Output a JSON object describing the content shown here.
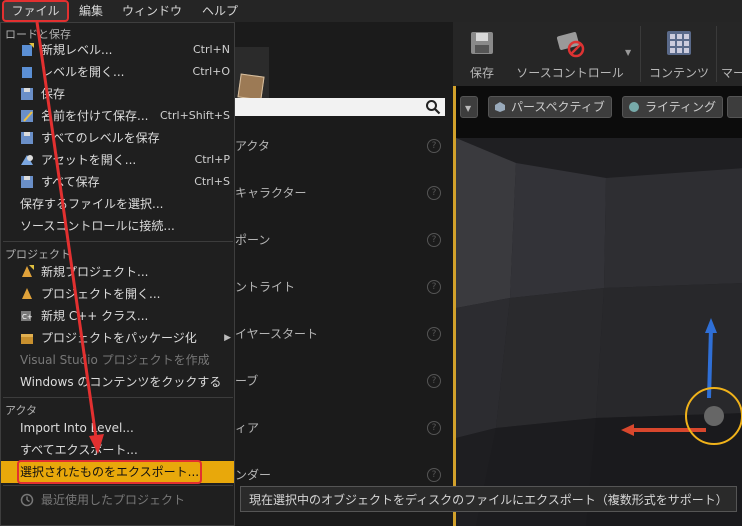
{
  "menubar": {
    "items": [
      "ファイル",
      "編集",
      "ウィンドウ",
      "ヘルプ"
    ]
  },
  "place_panel": {
    "search_placeholder": "",
    "items": [
      "アクタ",
      "キャラクター",
      "ポーン",
      "ントライト",
      "イヤースタート",
      "ーブ",
      "ィア",
      "ンダー"
    ]
  },
  "toolbar": {
    "save": "保存",
    "source_control": "ソースコントロール",
    "content": "コンテンツ",
    "more": "マー"
  },
  "viewport": {
    "perspective": "パースペクティブ",
    "lighting": "ライティング"
  },
  "file_menu": {
    "load_save": {
      "header": "ロードと保存",
      "items": [
        {
          "label": "新規レベル...",
          "shortcut": "Ctrl+N",
          "icon": "new-level-icon"
        },
        {
          "label": "レベルを開く...",
          "shortcut": "Ctrl+O",
          "icon": "open-level-icon"
        },
        {
          "label": "保存",
          "shortcut": "",
          "icon": "save-icon"
        },
        {
          "label": "名前を付けて保存...",
          "shortcut": "Ctrl+Shift+S",
          "icon": "save-as-icon"
        },
        {
          "label": "すべてのレベルを保存",
          "shortcut": "",
          "icon": "save-all-levels-icon"
        },
        {
          "label": "アセットを開く...",
          "shortcut": "Ctrl+P",
          "icon": "open-asset-icon"
        },
        {
          "label": "すべて保存",
          "shortcut": "Ctrl+S",
          "icon": "save-all-icon"
        },
        {
          "label": "保存するファイルを選択...",
          "shortcut": "",
          "icon": ""
        },
        {
          "label": "ソースコントロールに接続...",
          "shortcut": "",
          "icon": ""
        }
      ]
    },
    "project": {
      "header": "プロジェクト",
      "items": [
        {
          "label": "新規プロジェクト...",
          "icon": "new-project-icon"
        },
        {
          "label": "プロジェクトを開く...",
          "icon": "open-project-icon"
        },
        {
          "label": "新規 C++ クラス...",
          "icon": "cpp-class-icon"
        },
        {
          "label": "プロジェクトをパッケージ化",
          "icon": "package-icon"
        },
        {
          "label": "Visual Studio プロジェクトを作成",
          "icon": ""
        },
        {
          "label": "Windows のコンテンツをクックする",
          "icon": ""
        }
      ]
    },
    "actor": {
      "header": "アクタ",
      "items": [
        "Import Into Level...",
        "すべてエクスポート...",
        "選択されたものをエクスポート..."
      ]
    },
    "recent": "最近使用したプロジェクト"
  },
  "tooltip": "現在選択中のオブジェクトをディスクのファイルにエクスポート（複数形式をサポート）",
  "colors": {
    "highlight": "#e8a80b",
    "annotation": "#e23030",
    "viewport_border": "#d2a12b"
  }
}
